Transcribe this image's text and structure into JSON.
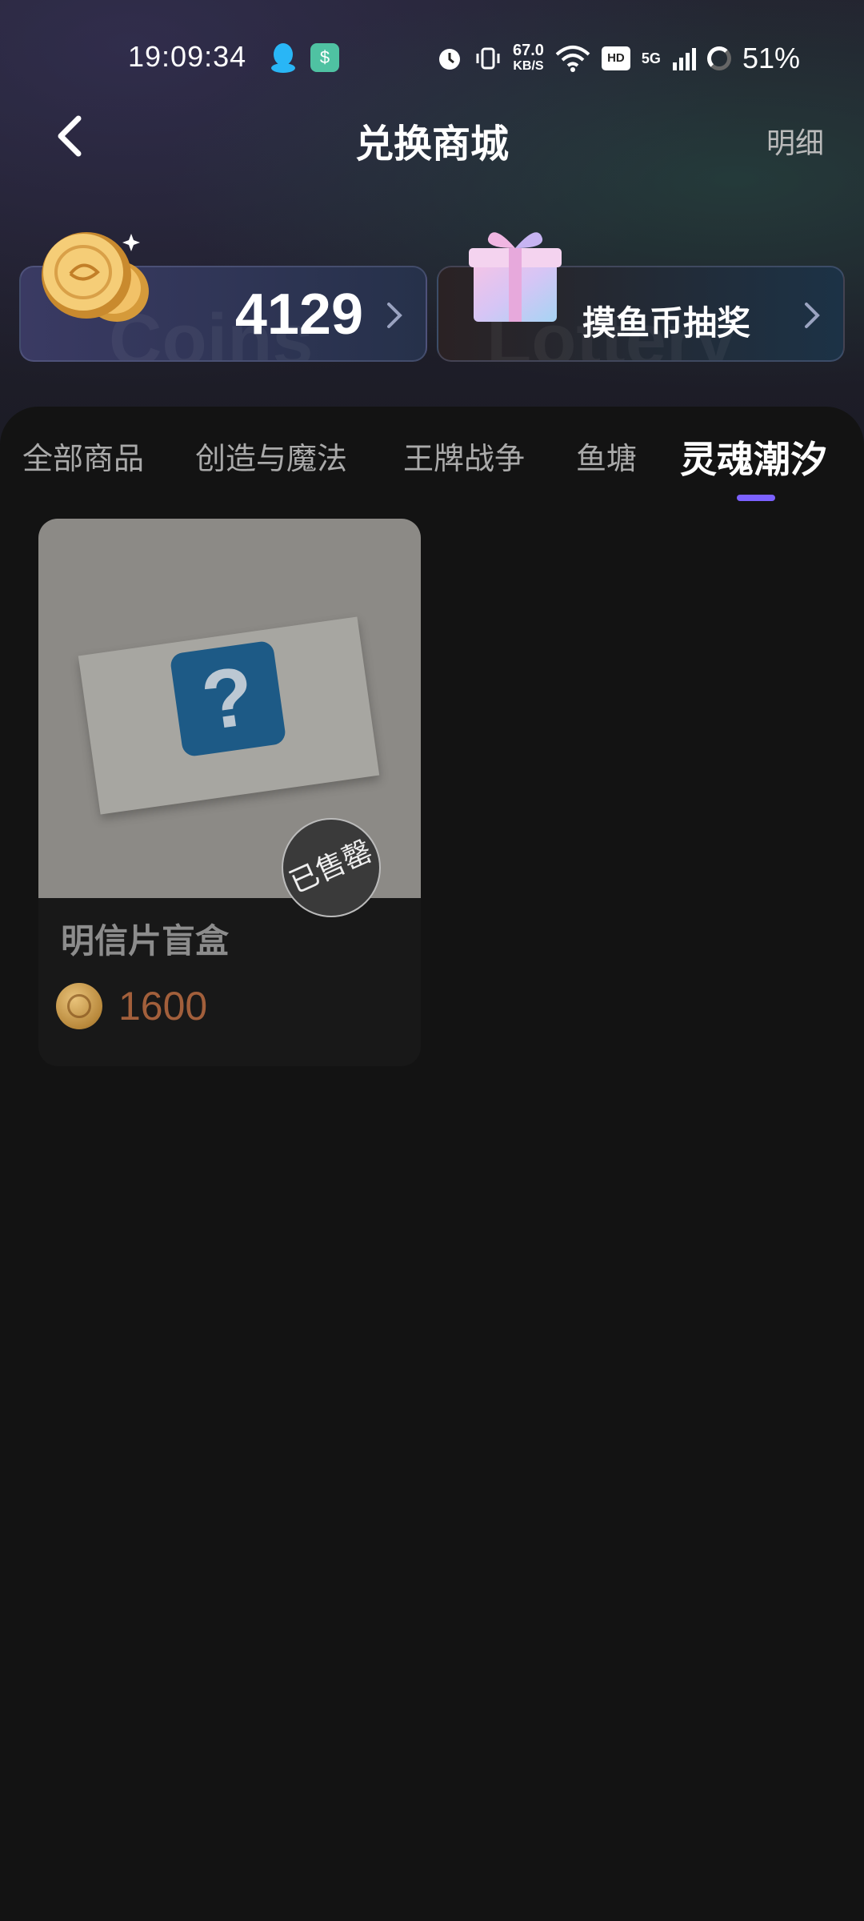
{
  "status_bar": {
    "time": "19:09:34",
    "net_speed_value": "67.0",
    "net_speed_unit": "KB/S",
    "hd": "HD",
    "network": "5G",
    "battery": "51%"
  },
  "header": {
    "title": "兑换商城",
    "detail_link": "明细"
  },
  "coins_card": {
    "amount": "4129",
    "watermark": "Coins"
  },
  "lottery_card": {
    "label": "摸鱼币抽奖",
    "watermark": "Lottery"
  },
  "tabs": [
    {
      "label": "全部商品"
    },
    {
      "label": "创造与魔法"
    },
    {
      "label": "王牌战争"
    },
    {
      "label": "鱼塘"
    },
    {
      "label": "灵魂潮汐",
      "active": true
    }
  ],
  "products": [
    {
      "name": "明信片盲盒",
      "price": "1600",
      "status": "已售罄"
    }
  ],
  "colors": {
    "background": "#131313",
    "tab_indicator": "#7b61ff",
    "price": "#a25f3b"
  }
}
